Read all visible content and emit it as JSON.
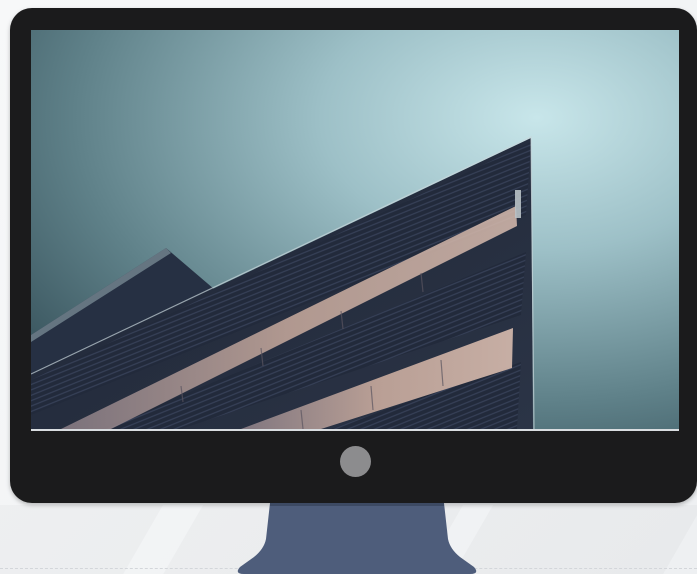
{
  "device": {
    "type": "desktop-monitor",
    "bezel_color": "#1b1b1c",
    "stand_color": "#4e5d7b",
    "power_button_color": "#8c8c8e"
  },
  "screen": {
    "content": "wallpaper-photo",
    "sky_color": "#8fb1b8",
    "building_color": "#20283a",
    "window_glow_color": "#c7a79a"
  },
  "background": {
    "color": "#f4f5f6"
  }
}
